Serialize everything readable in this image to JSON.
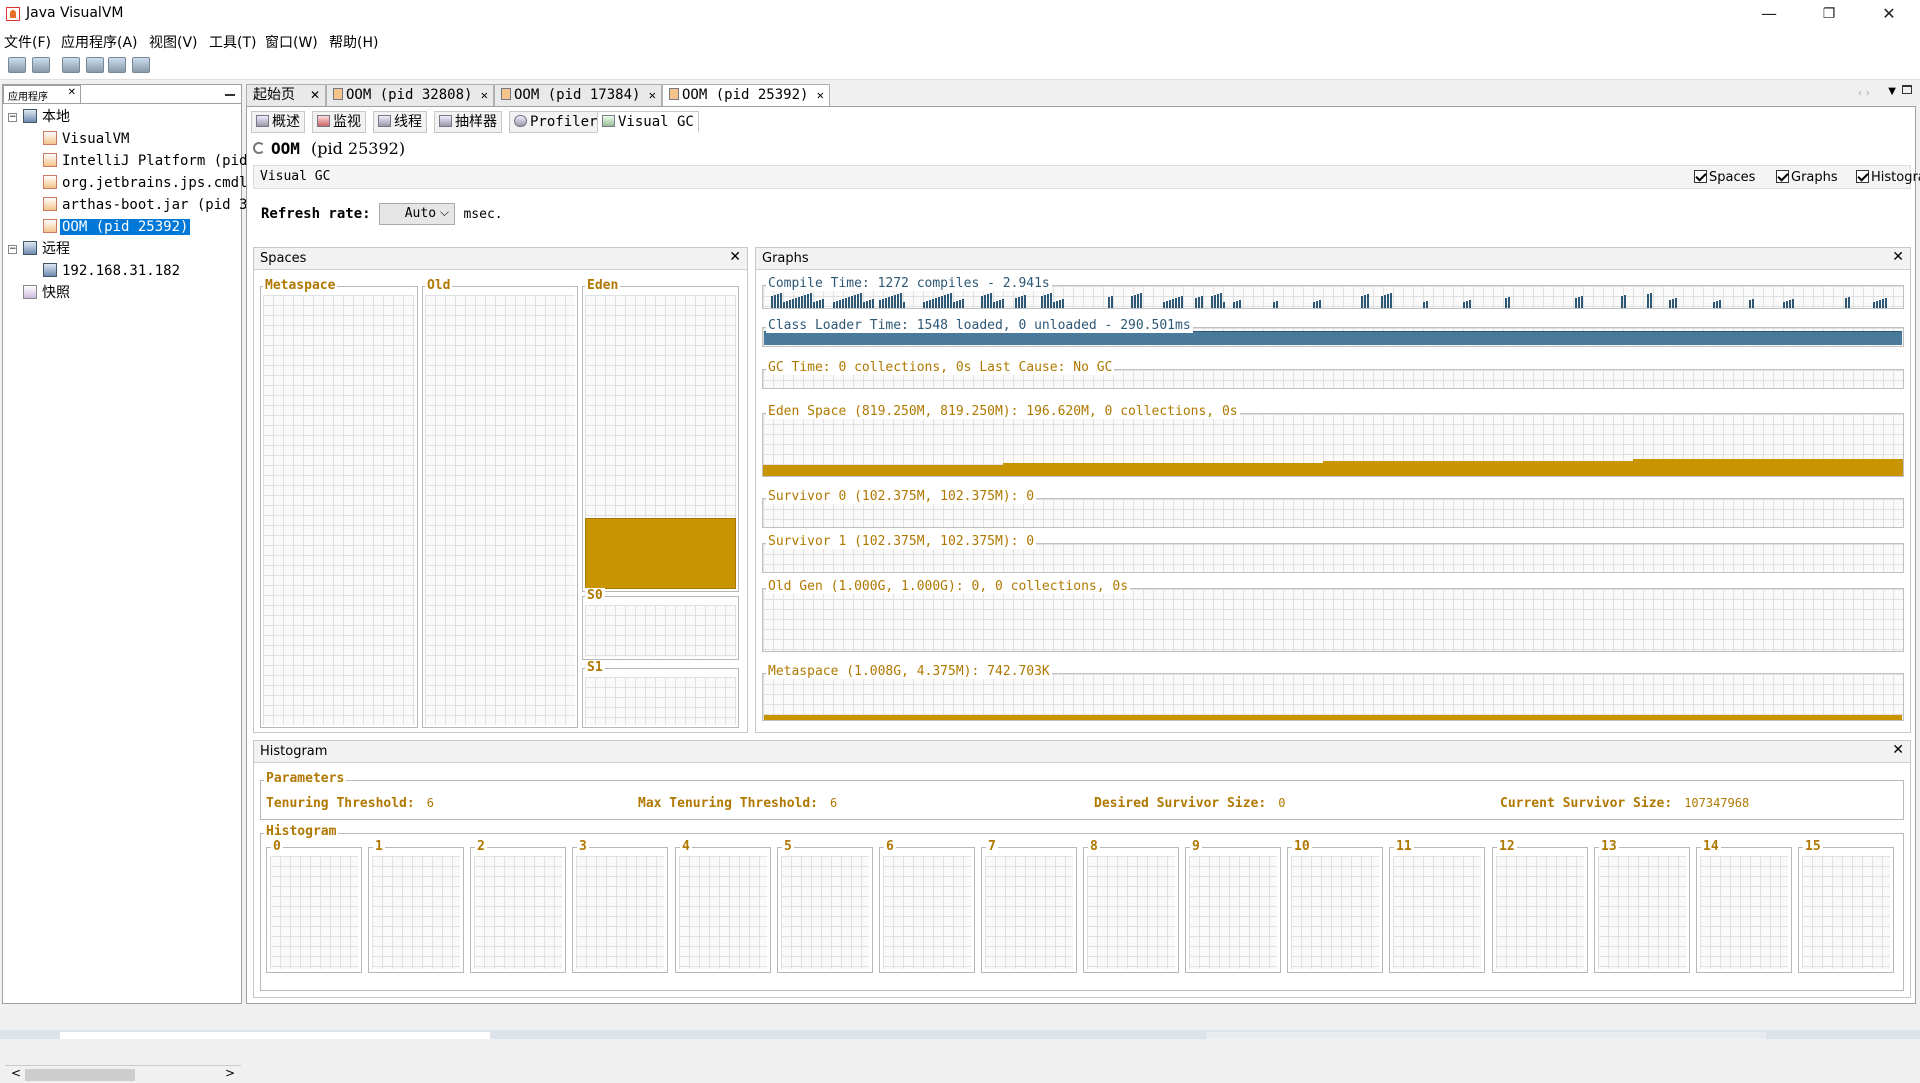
{
  "window": {
    "title": "Java VisualVM",
    "minimize": "—",
    "maximize": "❐",
    "close": "✕"
  },
  "menu": [
    "文件(F)",
    "应用程序(A)",
    "视图(V)",
    "工具(T)",
    "窗口(W)",
    "帮助(H)"
  ],
  "left_panel": {
    "tab_label": "应用程序",
    "tab_close": "✕",
    "tree": {
      "local": "本地",
      "local_items": [
        "VisualVM",
        "IntelliJ Platform (pid",
        "org.jetbrains.jps.cmdl",
        "arthas-boot.jar (pid 3",
        "OOM (pid 25392)"
      ],
      "remote": "远程",
      "remote_items": [
        "192.168.31.182"
      ],
      "snapshots": "快照"
    },
    "scroll_left": "<",
    "scroll_right": ">"
  },
  "doc_tabs": [
    {
      "label": "起始页",
      "close": "✕"
    },
    {
      "label": "OOM (pid 32808)",
      "close": "✕"
    },
    {
      "label": "OOM (pid 17384)",
      "close": "✕"
    },
    {
      "label": "OOM (pid 25392)",
      "close": "✕"
    }
  ],
  "sub_tabs": [
    "概述",
    "监视",
    "线程",
    "抽样器",
    "Profiler",
    "Visual GC"
  ],
  "page": {
    "app_name": "OOM",
    "pid": "(pid 25392)"
  },
  "visual_gc_bar": {
    "title": "Visual GC",
    "options": [
      {
        "label": "Spaces",
        "checked": true
      },
      {
        "label": "Graphs",
        "checked": true
      },
      {
        "label": "Histogram",
        "checked": true
      }
    ]
  },
  "refresh": {
    "label": "Refresh rate:",
    "value": "Auto",
    "unit": "msec."
  },
  "spaces_panel": {
    "title": "Spaces",
    "close": "✕",
    "spaces": [
      {
        "name": "Metaspace",
        "used_fraction": 0.0
      },
      {
        "name": "Old",
        "used_fraction": 0.0
      },
      {
        "name": "Eden",
        "used_fraction": 0.24
      },
      {
        "name": "S0",
        "used_fraction": 0.0
      },
      {
        "name": "S1",
        "used_fraction": 0.0
      }
    ]
  },
  "graphs_panel": {
    "title": "Graphs",
    "close": "✕",
    "graphs": [
      "Compile Time: 1272 compiles - 2.941s",
      "Class Loader Time: 1548 loaded, 0 unloaded - 290.501ms",
      "GC Time: 0 collections, 0s Last Cause: No GC",
      "Eden Space (819.250M, 819.250M): 196.620M, 0 collections, 0s",
      "Survivor 0 (102.375M, 102.375M): 0",
      "Survivor 1 (102.375M, 102.375M): 0",
      "Old Gen (1.000G, 1.000G): 0, 0 collections, 0s",
      "Metaspace (1.008G, 4.375M): 742.703K"
    ],
    "colors": {
      "blue": "#2d5876",
      "orange": "#c89400"
    }
  },
  "histogram_panel": {
    "title": "Histogram",
    "close": "✕",
    "parameters_title": "Parameters",
    "params": [
      {
        "label": "Tenuring Threshold:",
        "value": "6"
      },
      {
        "label": "Max Tenuring Threshold:",
        "value": "6"
      },
      {
        "label": "Desired Survivor Size:",
        "value": "0"
      },
      {
        "label": "Current Survivor Size:",
        "value": "107347968"
      }
    ],
    "histogram_title": "Histogram",
    "buckets": [
      "0",
      "1",
      "2",
      "3",
      "4",
      "5",
      "6",
      "7",
      "8",
      "9",
      "10",
      "11",
      "12",
      "13",
      "14",
      "15"
    ]
  }
}
